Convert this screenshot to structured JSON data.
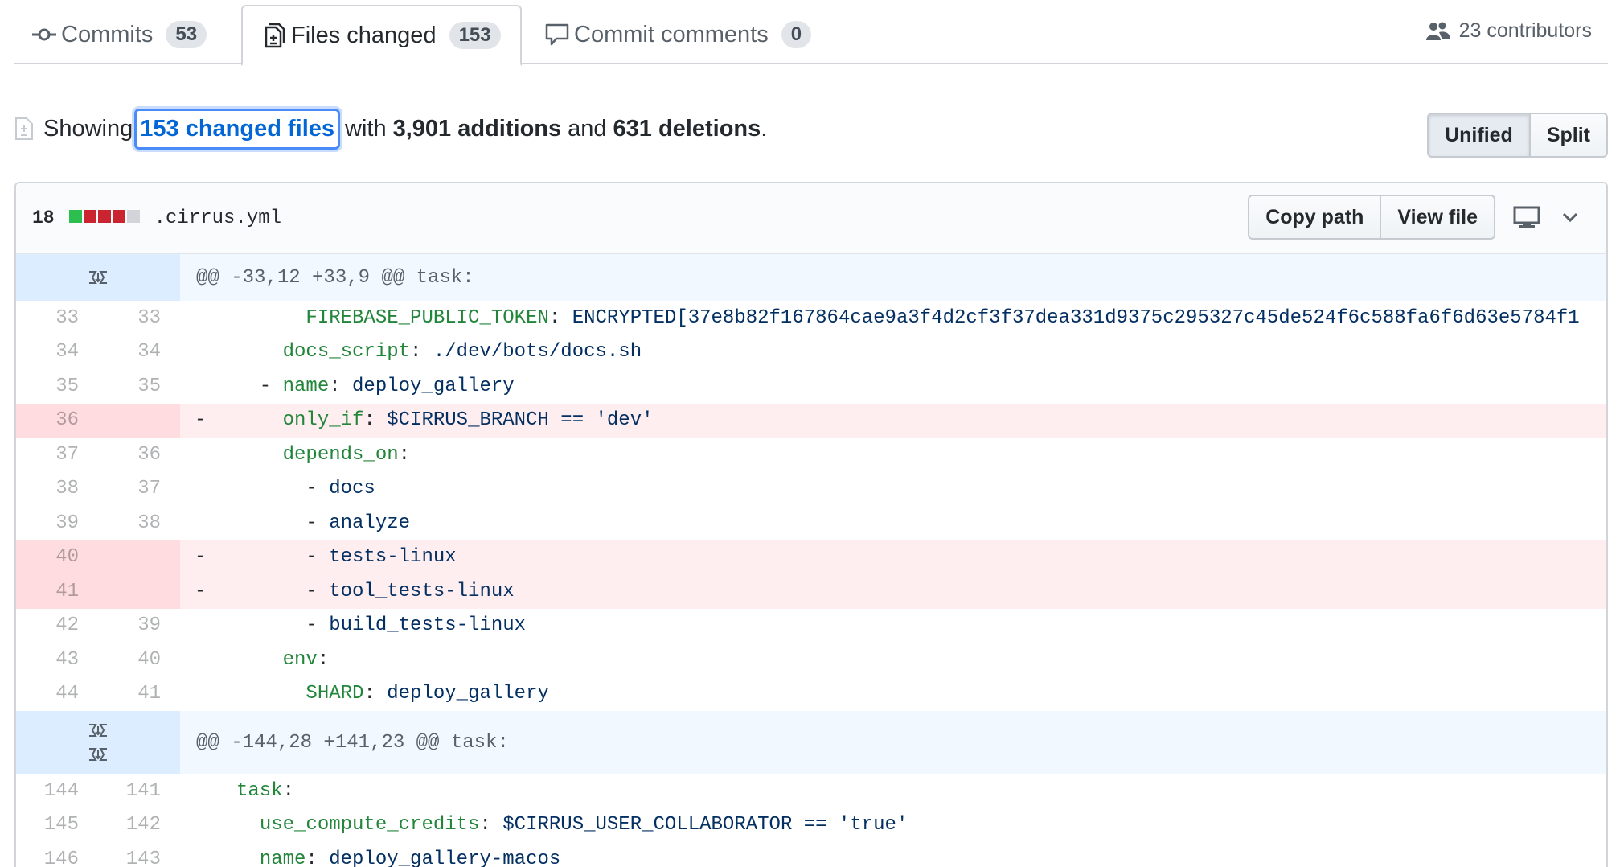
{
  "tabs": {
    "commits": {
      "label": "Commits",
      "count": "53"
    },
    "files": {
      "label": "Files changed",
      "count": "153"
    },
    "comments": {
      "label": "Commit comments",
      "count": "0"
    },
    "contributors": "23 contributors"
  },
  "summary": {
    "showing": "Showing",
    "changed_files": "153 changed files",
    "with": "with",
    "additions": "3,901 additions",
    "and": "and",
    "deletions": "631 deletions",
    "period": "."
  },
  "view_toggle": {
    "unified": "Unified",
    "split": "Split",
    "selected": "Unified"
  },
  "file": {
    "diffstat": "18",
    "diffstat_blocks": [
      "add",
      "del",
      "del",
      "del",
      "neutral"
    ],
    "colors": {
      "add": "#2cbe4e",
      "del": "#cb2431",
      "neutral": "#d1d5da"
    },
    "name": ".cirrus.yml",
    "copy_path": "Copy path",
    "view_file": "View file"
  },
  "hunks": [
    {
      "header": "@@ -33,12 +33,9 @@ task:",
      "lines": [
        {
          "type": "ctx",
          "old": "33",
          "new": "33",
          "indent": "      ",
          "key": "FIREBASE_PUBLIC_TOKEN",
          "sep": ": ",
          "val": "ENCRYPTED[37e8b82f167864cae9a3f4d2cf3f37dea331d9375c295327c45de524f6c588fa6f6d63e5784f1"
        },
        {
          "type": "ctx",
          "old": "34",
          "new": "34",
          "indent": "    ",
          "key": "docs_script",
          "sep": ": ",
          "val": "./dev/bots/docs.sh"
        },
        {
          "type": "ctx",
          "old": "35",
          "new": "35",
          "indent": "  - ",
          "key": "name",
          "sep": ": ",
          "val": "deploy_gallery"
        },
        {
          "type": "del",
          "old": "36",
          "new": "",
          "indent": "    ",
          "key": "only_if",
          "sep": ": ",
          "val": "$CIRRUS_BRANCH == 'dev'"
        },
        {
          "type": "ctx",
          "old": "37",
          "new": "36",
          "indent": "    ",
          "key": "depends_on",
          "sep": ":",
          "val": ""
        },
        {
          "type": "ctx",
          "old": "38",
          "new": "37",
          "indent": "      - ",
          "key": "",
          "sep": "",
          "val": "docs"
        },
        {
          "type": "ctx",
          "old": "39",
          "new": "38",
          "indent": "      - ",
          "key": "",
          "sep": "",
          "val": "analyze"
        },
        {
          "type": "del",
          "old": "40",
          "new": "",
          "indent": "      - ",
          "key": "",
          "sep": "",
          "val": "tests-linux"
        },
        {
          "type": "del",
          "old": "41",
          "new": "",
          "indent": "      - ",
          "key": "",
          "sep": "",
          "val": "tool_tests-linux"
        },
        {
          "type": "ctx",
          "old": "42",
          "new": "39",
          "indent": "      - ",
          "key": "",
          "sep": "",
          "val": "build_tests-linux"
        },
        {
          "type": "ctx",
          "old": "43",
          "new": "40",
          "indent": "    ",
          "key": "env",
          "sep": ":",
          "val": ""
        },
        {
          "type": "ctx",
          "old": "44",
          "new": "41",
          "indent": "      ",
          "key": "SHARD",
          "sep": ": ",
          "val": "deploy_gallery"
        }
      ]
    },
    {
      "header": "@@ -144,28 +141,23 @@ task:",
      "lines": [
        {
          "type": "ctx",
          "old": "144",
          "new": "141",
          "indent": "",
          "key": "task",
          "sep": ":",
          "val": ""
        },
        {
          "type": "ctx",
          "old": "145",
          "new": "142",
          "indent": "  ",
          "key": "use_compute_credits",
          "sep": ": ",
          "val": "$CIRRUS_USER_COLLABORATOR == 'true'"
        },
        {
          "type": "ctx",
          "old": "146",
          "new": "143",
          "indent": "  ",
          "key": "name",
          "sep": ": ",
          "val": "deploy_gallery-macos"
        }
      ]
    }
  ]
}
